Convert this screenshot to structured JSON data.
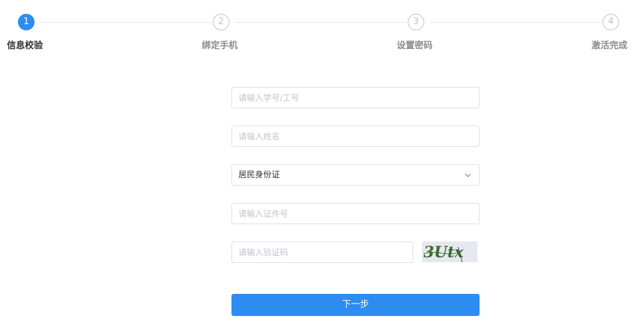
{
  "steps": [
    {
      "number": "1",
      "title": "信息校验",
      "active": true
    },
    {
      "number": "2",
      "title": "绑定手机",
      "active": false
    },
    {
      "number": "3",
      "title": "设置密码",
      "active": false
    },
    {
      "number": "4",
      "title": "激活完成",
      "active": false
    }
  ],
  "form": {
    "id_placeholder": "请输入学号/工号",
    "name_placeholder": "请输入姓名",
    "id_type_selected": "居民身份证",
    "cert_placeholder": "请输入证件号",
    "captcha_placeholder": "请输入验证码",
    "captcha_text": "3Utx",
    "next_label": "下一步"
  },
  "colors": {
    "accent": "#2d8cf0",
    "inactive": "#c0c4cc"
  }
}
